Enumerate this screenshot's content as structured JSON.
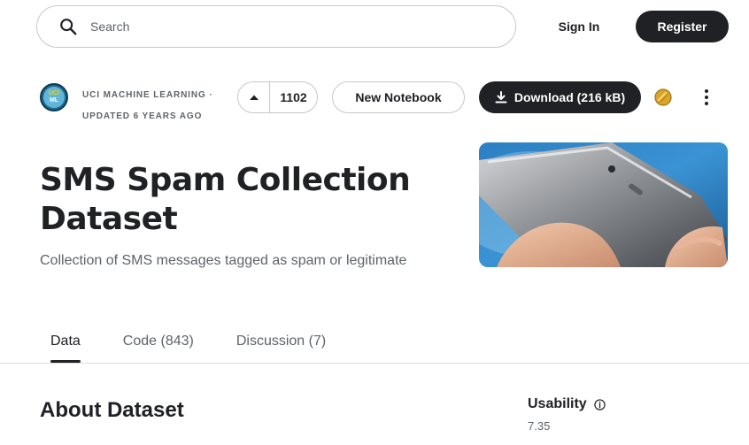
{
  "header": {
    "search_placeholder": "Search",
    "signin_label": "Sign In",
    "register_label": "Register"
  },
  "meta": {
    "avatar_line1": "UCI",
    "avatar_line2": "ML",
    "owner": "UCI MACHINE LEARNING ·",
    "updated": "UPDATED 6 YEARS AGO",
    "vote_count": "1102",
    "new_notebook_label": "New Notebook",
    "download_label": "Download (216 kB)"
  },
  "dataset": {
    "title": "SMS Spam Collection Dataset",
    "subtitle": "Collection of SMS messages tagged as spam or legitimate"
  },
  "tabs": [
    {
      "label": "Data",
      "active": true
    },
    {
      "label": "Code (843)",
      "active": false
    },
    {
      "label": "Discussion (7)",
      "active": false
    }
  ],
  "about": {
    "heading": "About Dataset",
    "usability_label": "Usability",
    "usability_value": "7.35"
  },
  "colors": {
    "primary_dark": "#202124",
    "secondary_text": "#5f6368",
    "border": "#c8c8cc",
    "medal": "#d9a52b"
  },
  "icons": {
    "search": "search-icon",
    "upvote": "caret-up-icon",
    "download": "download-icon",
    "medal": "medal-icon",
    "more": "kebab-icon",
    "info": "info-icon"
  }
}
